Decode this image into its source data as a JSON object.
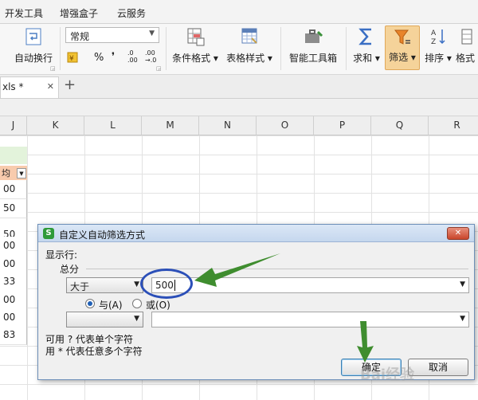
{
  "menu": [
    "开发工具",
    "增强盒子",
    "云服务"
  ],
  "ribbon": {
    "wrap_text": "自动换行",
    "number_format": "常规",
    "percent": "%",
    "comma": "❜",
    "dec_inc": ".0\n.00",
    "dec_dec": ".00\n→.0",
    "conditional_format": "条件格式",
    "table_style": "表格样式",
    "smart_toolbox": "智能工具箱",
    "sum": "求和",
    "filter": "筛选",
    "sort": "排序",
    "format": "格式"
  },
  "doc_tab": {
    "label": "xls *",
    "close": "✕",
    "new": "+"
  },
  "columns": [
    "J",
    "K",
    "L",
    "M",
    "N",
    "O",
    "P",
    "Q",
    "R"
  ],
  "col_j": {
    "header_cell": "均",
    "values": [
      "00",
      "50",
      "",
      "50",
      "00",
      "00",
      "33",
      "00",
      "00",
      "83"
    ]
  },
  "dialog": {
    "title": "自定义自动筛选方式",
    "close": "✕",
    "show_rows": "显示行:",
    "field": "总分",
    "op1": "大于",
    "value1": "500",
    "and_label": "与(A)",
    "or_label": "或(O)",
    "op2": "",
    "value2": "",
    "hint1": "可用 ? 代表单个字符",
    "hint2": "用 * 代表任意多个字符",
    "ok": "确定",
    "cancel": "取消"
  },
  "watermark": "Bai经验",
  "colors": {
    "accent": "#2b4fb8",
    "arrow": "#3f8d2f",
    "filter_active": "#f5c27a"
  }
}
